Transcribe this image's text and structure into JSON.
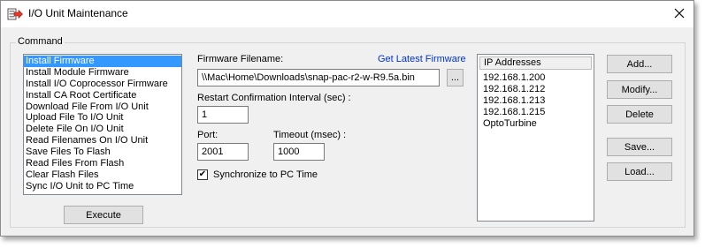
{
  "window": {
    "title": "I/O Unit Maintenance"
  },
  "command_group": {
    "label": "Command",
    "items": [
      "Install Firmware",
      "Install Module Firmware",
      "Install I/O Coprocessor Firmware",
      "Install CA Root Certificate",
      "Download File From I/O Unit",
      "Upload File To I/O Unit",
      "Delete File On I/O Unit",
      "Read Filenames On I/O Unit",
      "Save Files To Flash",
      "Read Files From Flash",
      "Clear Flash Files",
      "Sync I/O Unit to PC Time"
    ],
    "selected_index": 0,
    "execute_label": "Execute"
  },
  "firmware": {
    "filename_label": "Firmware Filename:",
    "get_latest_link": "Get Latest Firmware",
    "filename_value": "\\\\Mac\\Home\\Downloads\\snap-pac-r2-w-R9.5a.bin",
    "browse_label": "..."
  },
  "restart": {
    "label": "Restart Confirmation Interval (sec) :",
    "value": "1"
  },
  "port": {
    "label": "Port:",
    "value": "2001"
  },
  "timeout": {
    "label": "Timeout (msec) :",
    "value": "1000"
  },
  "sync": {
    "label": "Synchronize to PC Time",
    "checked": true,
    "check_glyph": "✔"
  },
  "ip_list": {
    "header": "IP Addresses",
    "items": [
      "192.168.1.200",
      "192.168.1.212",
      "192.168.1.213",
      "192.168.1.215",
      "OptoTurbine"
    ]
  },
  "side_buttons": {
    "add": "Add...",
    "modify": "Modify...",
    "delete": "Delete",
    "save": "Save...",
    "load": "Load..."
  },
  "colors": {
    "selection": "#3399ff",
    "link": "#0033cc",
    "app_icon_red": "#e03a2a"
  }
}
